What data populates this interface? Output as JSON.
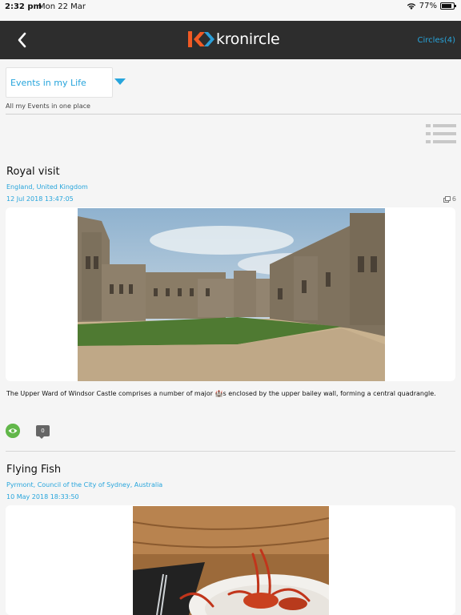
{
  "status_bar": {
    "time": "2:32 pm",
    "date": "Mon 22 Mar",
    "battery": "77%",
    "battery_level": 0.77
  },
  "nav": {
    "app_name": "kronircle",
    "circles_label": "Circles(4)",
    "icons": [
      "back-chevron-icon",
      "kronircle-logo"
    ]
  },
  "filter": {
    "selected": "Events in my Life",
    "subtitle": "All my Events in one place"
  },
  "colors": {
    "accent": "#27a5dc",
    "header": "#2d2d2d",
    "logo_orange": "#f15a24",
    "views_green": "#62b74a"
  },
  "events": [
    {
      "title": "Royal visit",
      "location": "England, United Kingdom",
      "datetime": "12 Jul 2018  13:47:05",
      "media_count": "6",
      "description": "The Upper Ward of Windsor Castle comprises a number of major 🏰s enclosed by the upper bailey wall, forming a central quadrangle.",
      "comments": "0",
      "image": "windsor-castle-photo"
    },
    {
      "title": "Flying Fish",
      "location": "Pyrmont, Council of the City of Sydney, Australia",
      "datetime": "10 May 2018  18:33:50",
      "image": "crayfish-dish-photo"
    }
  ]
}
